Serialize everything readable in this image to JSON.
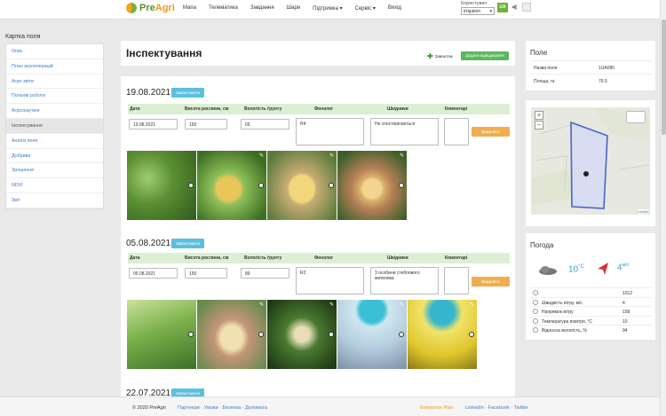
{
  "brand": {
    "name_part1": "Pre",
    "name_part2": "Agri"
  },
  "nav": [
    "Мапа",
    "Телематика",
    "Завдання",
    "Шари",
    "Підтримка ▾",
    "Сервіс ▾",
    "Вихід"
  ],
  "user": {
    "label": "Користувач",
    "value": "irrigation",
    "lang": "UA"
  },
  "sidebar": {
    "title": "Картка поля",
    "items": [
      "Опис",
      "План агрооперацій",
      "Агро-звіти",
      "Польові роботи",
      "Агроскаутинг",
      "Інспектування",
      "Аналіз поля",
      "Добрива",
      "Зрошення",
      "NDVI",
      "Звіт"
    ],
    "active_index": 5
  },
  "header": {
    "title": "Інспектування",
    "download": "Завантаж",
    "add": "Додати відвідування"
  },
  "columns": [
    "Дата",
    "Висота рослини, см",
    "Вологість ґрунту",
    "Фенолог",
    "Шкідники",
    "Коментарі"
  ],
  "inspections": [
    {
      "date": "19.08.2021",
      "upload": "Завантажити",
      "values": {
        "date": "19.08.2021",
        "height": "150",
        "moisture": "65",
        "phenology": "R4",
        "pests": "Не спостерігаються",
        "comment": ""
      },
      "delete": "Видалити"
    },
    {
      "date": "05.08.2021",
      "upload": "Завантажити",
      "values": {
        "date": "05.08.2021",
        "height": "150",
        "moisture": "89",
        "phenology": "R2",
        "pests": "3 особини стеблового метелика",
        "comment": ""
      },
      "delete": "Видалити"
    },
    {
      "date": "22.07.2021",
      "upload": "Завантажити"
    }
  ],
  "field": {
    "title": "Поле",
    "rows": [
      {
        "label": "Назва поля",
        "value": "1UA095"
      },
      {
        "label": "Площа, га",
        "value": "76.5"
      }
    ],
    "map_zoom_in": "+",
    "map_zoom_out": "−",
    "attribution": "Leaflet"
  },
  "weather": {
    "title": "Погода",
    "temp": "10",
    "temp_unit": "°C",
    "wind": "4",
    "wind_unit": "м/с",
    "rows": [
      {
        "label": "",
        "value": "1012"
      },
      {
        "label": "Швидкість вітру, м/с",
        "value": "4"
      },
      {
        "label": "Напрямок вітру",
        "value": "158"
      },
      {
        "label": "Температура повітря, °С",
        "value": "10"
      },
      {
        "label": "Відносна вологість, %",
        "value": "94"
      }
    ]
  },
  "footer": {
    "copyright": "© 2020 PreAgri",
    "links": "Партнери · Умови · Безпека · Допомога",
    "plan": "Enterprise Plan",
    "social": "LinkedIn · Facebook · Twitter"
  },
  "colors": {
    "brand_green": "#5a8f2c",
    "brand_orange": "#e89a1b",
    "table_head": "#dcefd2",
    "upload_btn": "#5bc0de",
    "delete_btn": "#f0ad4e",
    "add_btn": "#5cb85c"
  }
}
